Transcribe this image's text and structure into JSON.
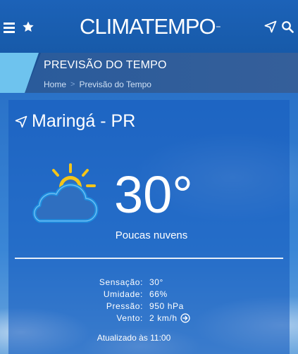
{
  "header": {
    "logo_text": "CLIMATEMPO",
    "icons": [
      "menu-icon",
      "star-icon",
      "location-arrow-icon",
      "search-icon"
    ]
  },
  "band": {
    "title": "PREVISÃO DO TEMPO",
    "breadcrumb": [
      "Home",
      "Previsão do Tempo"
    ]
  },
  "weather": {
    "city": "Maringá - PR",
    "temperature": "30°",
    "condition": "Poucas nuvens",
    "details": [
      {
        "label": "Sensação:",
        "value": "30°"
      },
      {
        "label": "Umidade:",
        "value": "66%"
      },
      {
        "label": "Pressão:",
        "value": "950 hPa"
      },
      {
        "label": "Vento:",
        "value": "2 km/h"
      }
    ],
    "updated": "Atualizado às 11:00"
  },
  "colors": {
    "header_bg": "#1c62b8",
    "band_bg": "#1a4f93",
    "accent": "#6ec3ee",
    "sun": "#f5c518",
    "cloud_outline": "#1e8fe0"
  }
}
